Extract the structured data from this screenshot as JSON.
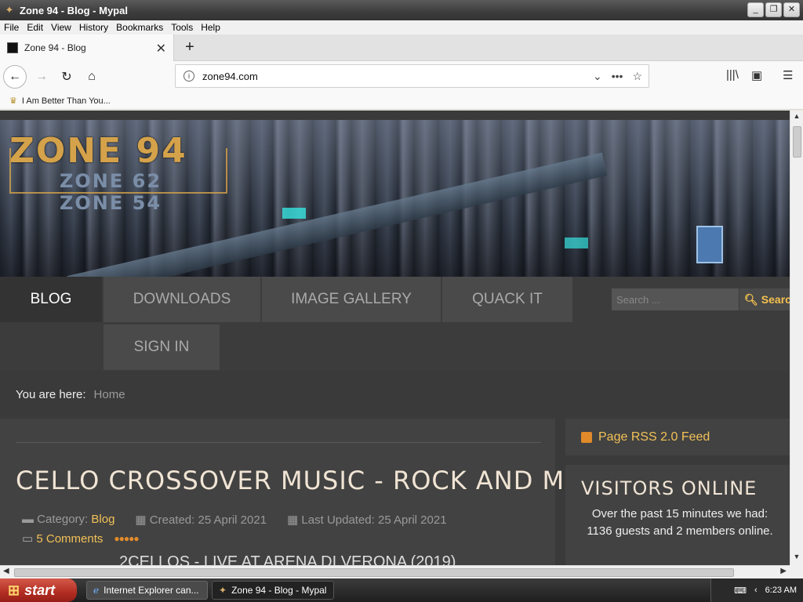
{
  "window": {
    "title": "Zone 94 - Blog - Mypal",
    "controls": {
      "minimize": "_",
      "restore": "❐",
      "close": "✕"
    }
  },
  "menubar": {
    "items": [
      "File",
      "Edit",
      "View",
      "History",
      "Bookmarks",
      "Tools",
      "Help"
    ]
  },
  "tabs": [
    {
      "label": "Zone 94 - Blog",
      "active": true
    }
  ],
  "navbar": {
    "url": "zone94.com"
  },
  "bookmarks": {
    "items": [
      "I Am Better Than You..."
    ]
  },
  "site": {
    "logo": {
      "main": "ZONE 94",
      "sub1": "ZONE 62",
      "sub2": "ZONE 54"
    },
    "menu": [
      "BLOG",
      "DOWNLOADS",
      "IMAGE GALLERY",
      "QUACK IT",
      "SIGN IN"
    ],
    "search": {
      "placeholder": "Search ...",
      "button": "Searc"
    },
    "breadcrumbs": {
      "label": "You are here:",
      "home": "Home"
    },
    "article": {
      "title": "CELLO CROSSOVER MUSIC - ROCK AND METAL",
      "category_label": "Category:",
      "category": "Blog",
      "created": "Created: 25 April 2021",
      "updated": "Last Updated: 25 April 2021",
      "comments": "5 Comments",
      "rating_stars": 5,
      "next_heading": "2CELLOS - LIVE AT ARENA DI VERONA (2019)"
    },
    "sidebar": {
      "rss": "Page RSS 2.0 Feed",
      "visitors_title": "VISITORS ONLINE",
      "visitors_text": "Over the past 15 minutes we had: 1136 guests and 2 members online."
    }
  },
  "taskbar": {
    "start": "start",
    "tasks": [
      "Internet Explorer can...",
      "Zone 94 - Blog - Mypal"
    ],
    "clock": "6:23 AM"
  },
  "colors": {
    "accent": "#f2c156",
    "page_bg": "#3a3a3a",
    "title_text": "#f0e4d4"
  }
}
